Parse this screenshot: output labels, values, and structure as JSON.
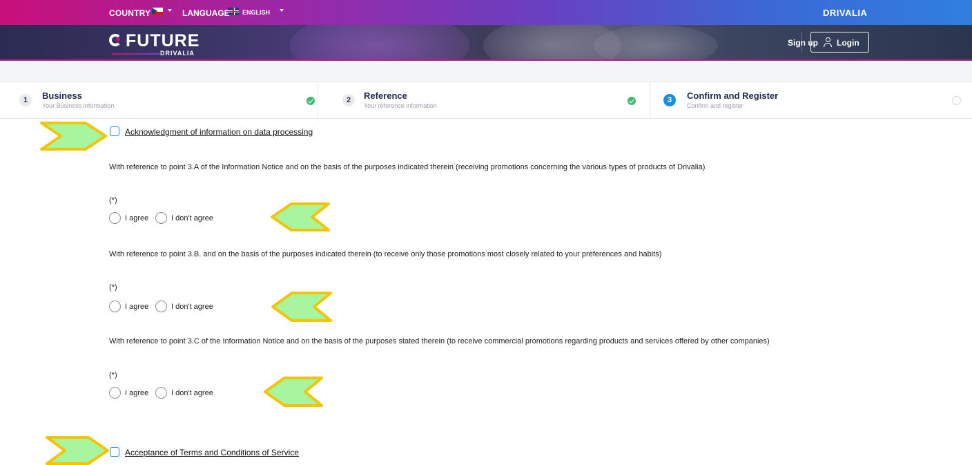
{
  "topbar": {
    "country_label": "COUNTRY",
    "country_flag_icon": "czech-flag-icon",
    "language_label": "LANGUAGE",
    "language_flag_icon": "uk-flag-icon",
    "language_value": "ENGLISH",
    "brand": "DRIVALIA"
  },
  "hero": {
    "logo_main": "FUTURE",
    "logo_sub": "DRIVALIA",
    "signup_label": "Sign up",
    "login_label": "Login",
    "login_icon": "user-icon"
  },
  "stepper": {
    "steps": [
      {
        "number": "1",
        "title": "Business",
        "subtitle": "Your Business information",
        "status": "complete"
      },
      {
        "number": "2",
        "title": "Reference",
        "subtitle": "Your reference information",
        "status": "complete"
      },
      {
        "number": "3",
        "title": "Confirm and Register",
        "subtitle": "Confirm and register",
        "status": "active"
      }
    ]
  },
  "form": {
    "ack_label": "Acknowledgment of information on data processing",
    "questions": [
      {
        "text": "With reference to point 3.A of the Information Notice and on the basis of the purposes indicated therein (receiving promotions concerning the various types of products of Drivalia)",
        "required_mark": "(*)",
        "agree": "I agree",
        "disagree": "I don't agree"
      },
      {
        "text": "With reference to point 3.B. and on the basis of the purposes indicated therein (to receive only those promotions most closely related to your preferences and habits)",
        "required_mark": "(*)",
        "agree": "I agree",
        "disagree": "I don't agree"
      },
      {
        "text": "With reference to point 3.C of the Information Notice and on the basis of the purposes stated therein (to receive commercial promotions regarding products and services offered by other companies)",
        "required_mark": "(*)",
        "agree": "I agree",
        "disagree": "I don't agree"
      }
    ],
    "terms_label": "Acceptance of Terms and Conditions of Service"
  },
  "colors": {
    "accent_blue": "#1d8fd6",
    "success_green": "#43b870",
    "annotation_fill": "#a8f5a0",
    "annotation_border": "#f5c400"
  }
}
